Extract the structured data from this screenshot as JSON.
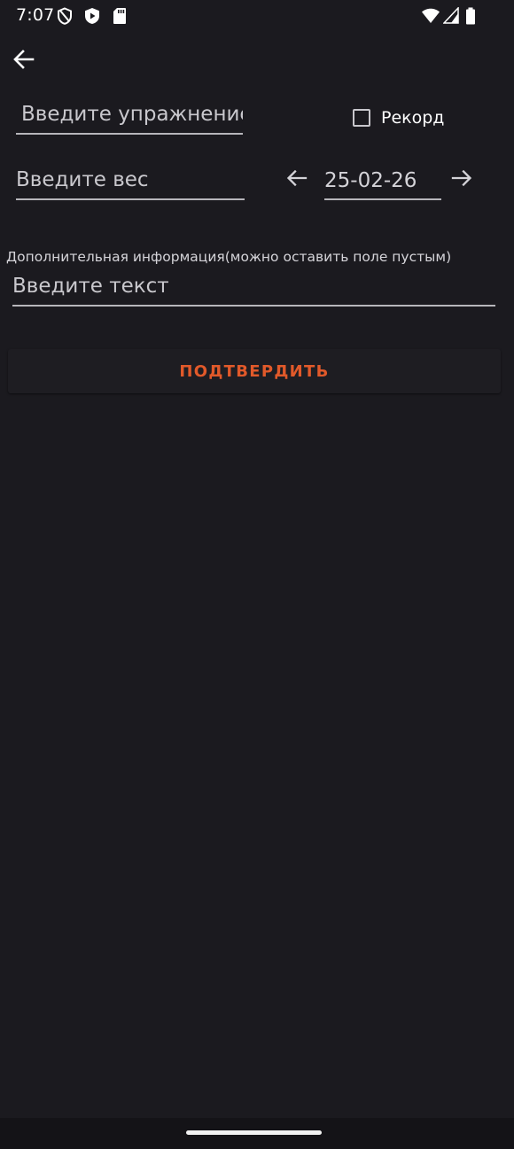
{
  "status_bar": {
    "time": "7:07",
    "left_icons": [
      "shield-outline-icon",
      "play-shield-icon",
      "sd-card-icon"
    ],
    "right_icons": [
      "wifi-icon",
      "signal-icon",
      "battery-icon"
    ]
  },
  "toolbar": {
    "back_icon": "arrow-left-icon"
  },
  "form": {
    "exercise_placeholder": "Введите упражнение",
    "record_label": "Рекорд",
    "record_checked": false,
    "weight_placeholder": "Введите вес",
    "date_value": "25-02-26",
    "prev_date_icon": "arrow-left-icon",
    "next_date_icon": "arrow-right-icon",
    "info_label": "Дополнительная информация(можно оставить поле пустым)",
    "info_placeholder": "Введите текст",
    "confirm_label": "ПОДТВЕРДИТЬ"
  },
  "colors": {
    "background": "#1b1a1f",
    "accent": "#e1592a",
    "text": "#ffffff",
    "hint": "#c9c8cd"
  }
}
